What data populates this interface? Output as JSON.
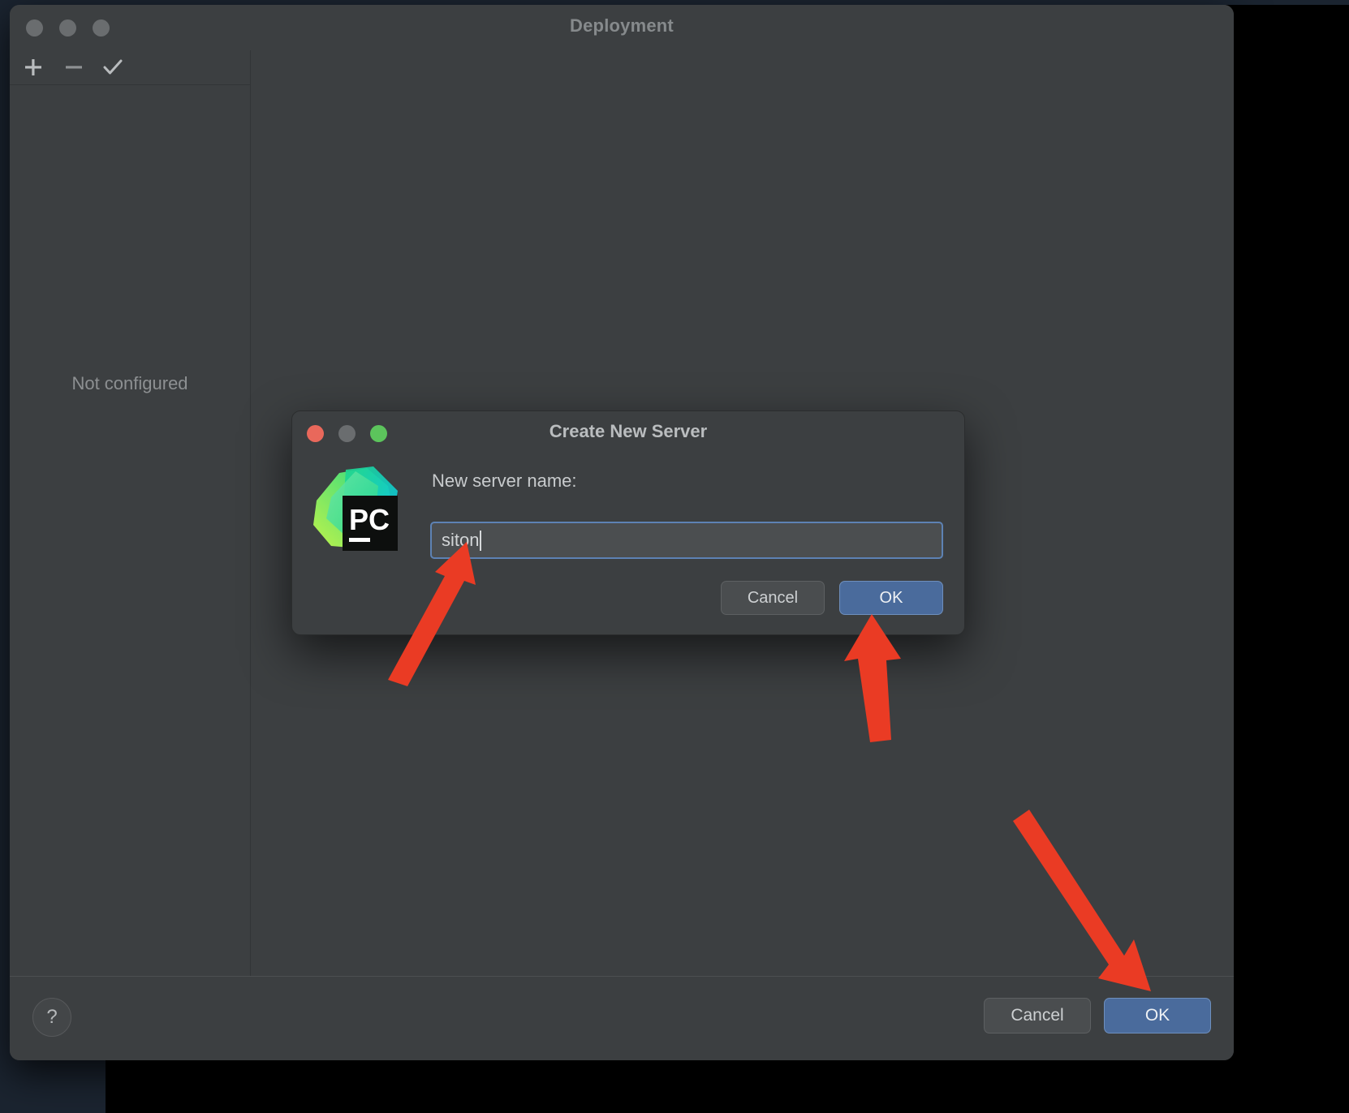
{
  "window": {
    "title": "Deployment",
    "traffic_lights": [
      "close",
      "minimize",
      "zoom"
    ],
    "toolbar": {
      "add_label": "+",
      "remove_label": "−",
      "validate_label": "✓"
    },
    "left_panel": {
      "empty_state": "Not configured"
    },
    "footer": {
      "help_label": "?",
      "cancel_label": "Cancel",
      "ok_label": "OK"
    }
  },
  "dialog": {
    "title": "Create New Server",
    "traffic_lights": [
      "close",
      "minimize",
      "zoom"
    ],
    "logo_text": "PC",
    "field_label": "New server name:",
    "field_value": "siton",
    "field_placeholder": "",
    "cancel_label": "Cancel",
    "ok_label": "OK"
  },
  "annotations": {
    "arrow_color": "#ea3b24",
    "arrows": [
      {
        "name": "arrow-to-server-name-input",
        "target": "dialog name field"
      },
      {
        "name": "arrow-to-dialog-ok",
        "target": "dialog OK button"
      },
      {
        "name": "arrow-to-window-ok",
        "target": "window OK button"
      }
    ]
  },
  "colors": {
    "window_bg": "#3c3f41",
    "accent_blue": "#4a6b9c",
    "focus_border": "#5d82b4",
    "annotation_red": "#ea3b24",
    "text_primary": "#cdd0d2",
    "text_muted": "#8d9092"
  }
}
